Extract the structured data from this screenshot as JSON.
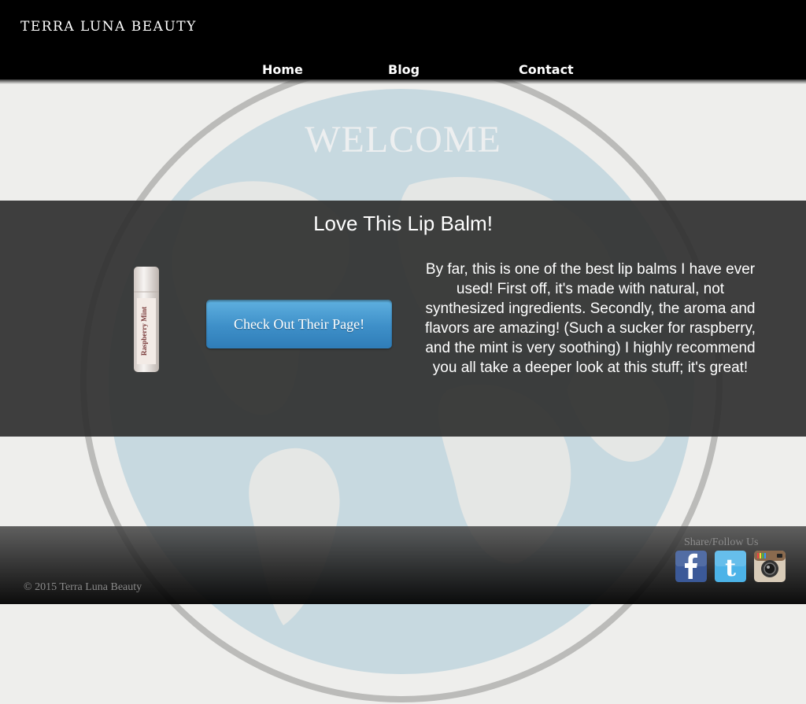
{
  "header": {
    "site_title": "TERRA LUNA BEAUTY",
    "nav": [
      "Home",
      "Blog",
      "Contact"
    ]
  },
  "hero": {
    "welcome": "WELCOME"
  },
  "review": {
    "title": "Love This Lip Balm!",
    "product_label": "Raspberry Mint",
    "cta": "Check Out Their Page!",
    "text": "By far, this is one of the best lip balms I have ever used! First off, it's made with natural, not synthesized ingredients. Secondly, the aroma and flavors are amazing! (Such a sucker for raspberry, and the mint is very soothing) I highly recommend you all take a deeper look at this stuff; it's great!"
  },
  "footer": {
    "copyright": "© 2015 Terra Luna Beauty",
    "share_label": "Share/Follow Us",
    "social": [
      {
        "name": "facebook-icon",
        "color": "#3b5998"
      },
      {
        "name": "twitter-icon",
        "color": "#4cb3e8"
      },
      {
        "name": "instagram-icon",
        "color": "#8a6a4e"
      }
    ]
  },
  "colors": {
    "header_bg": "#000000",
    "panel_bg": "#303030",
    "button_blue": "#3e8fc8",
    "page_bg": "#eeeeec"
  }
}
